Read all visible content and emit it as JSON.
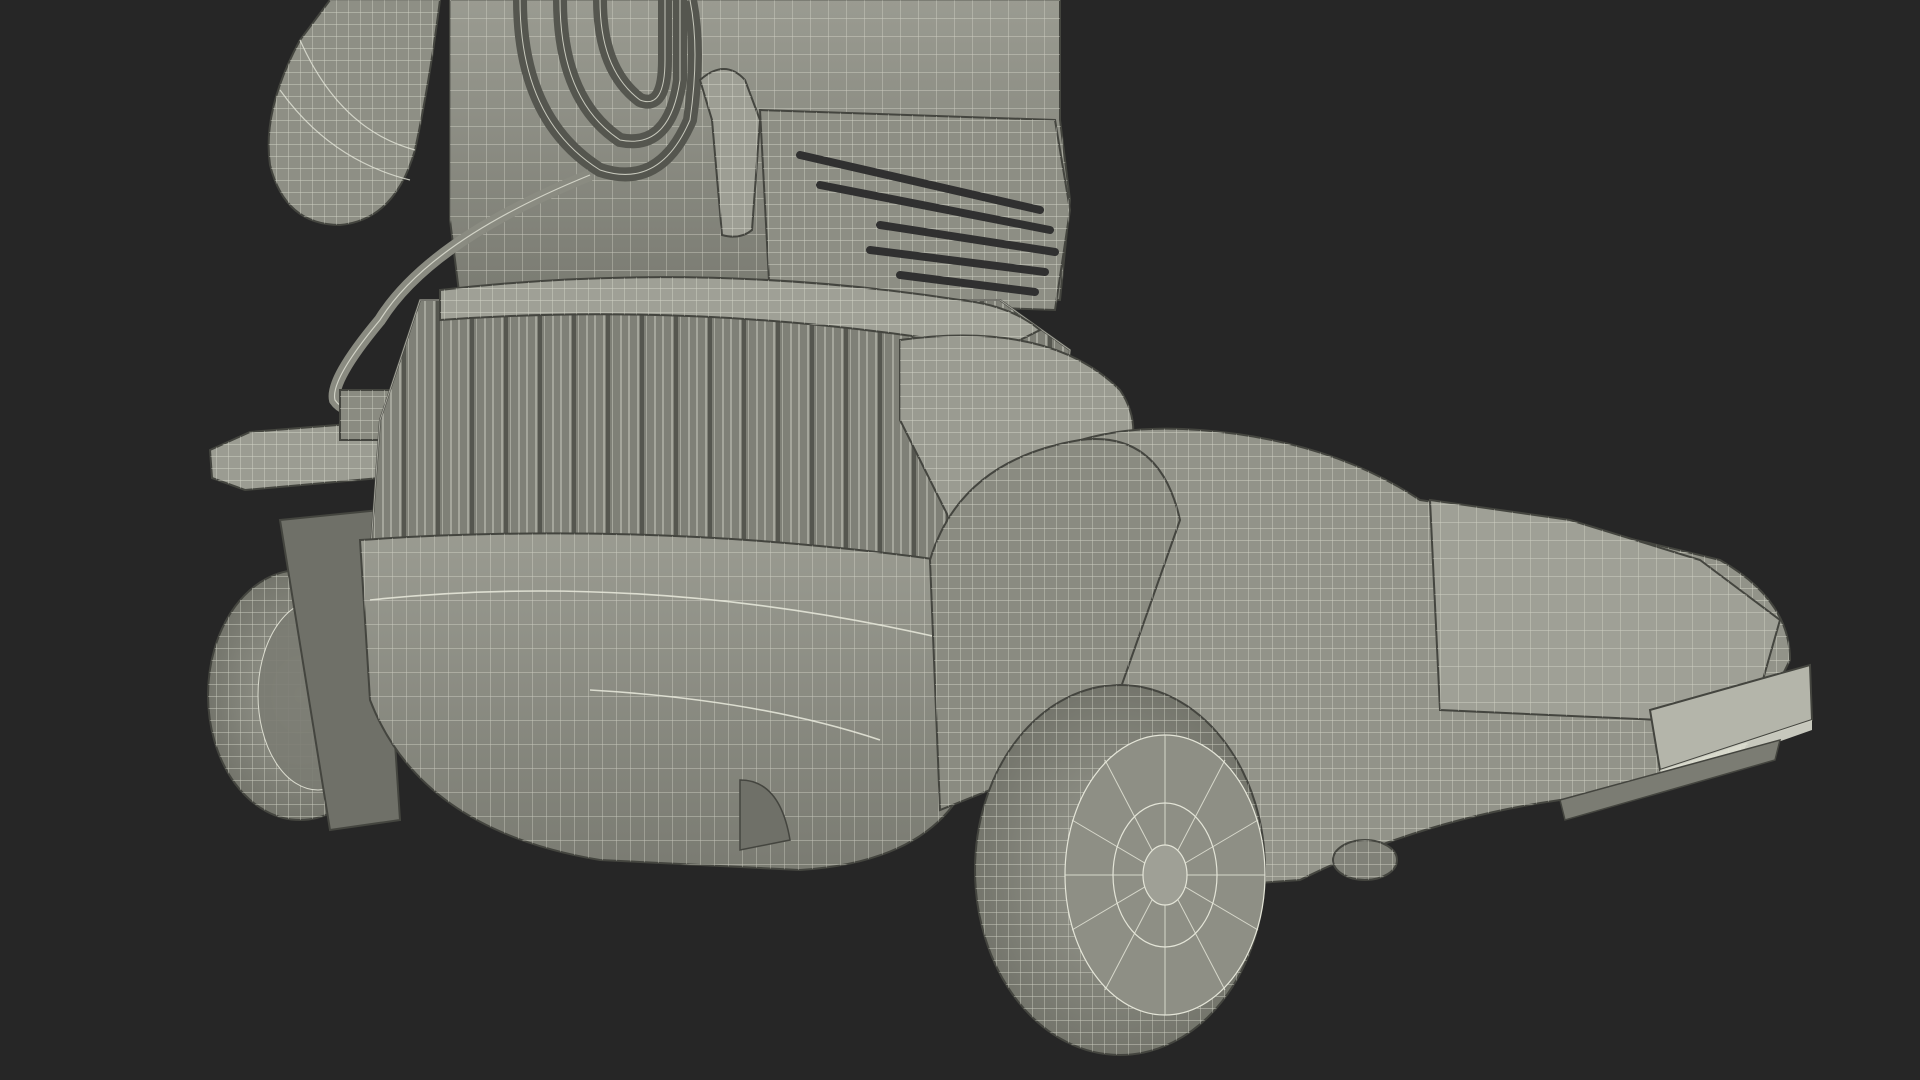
{
  "scene": {
    "subject": "wireframe-render",
    "colors": {
      "background": "#262626",
      "surface": "#8b8c82",
      "surface_light": "#a2a399",
      "surface_dark": "#6e6f66",
      "wire": "#e4e5d8",
      "shadow_line": "#44453f"
    }
  }
}
